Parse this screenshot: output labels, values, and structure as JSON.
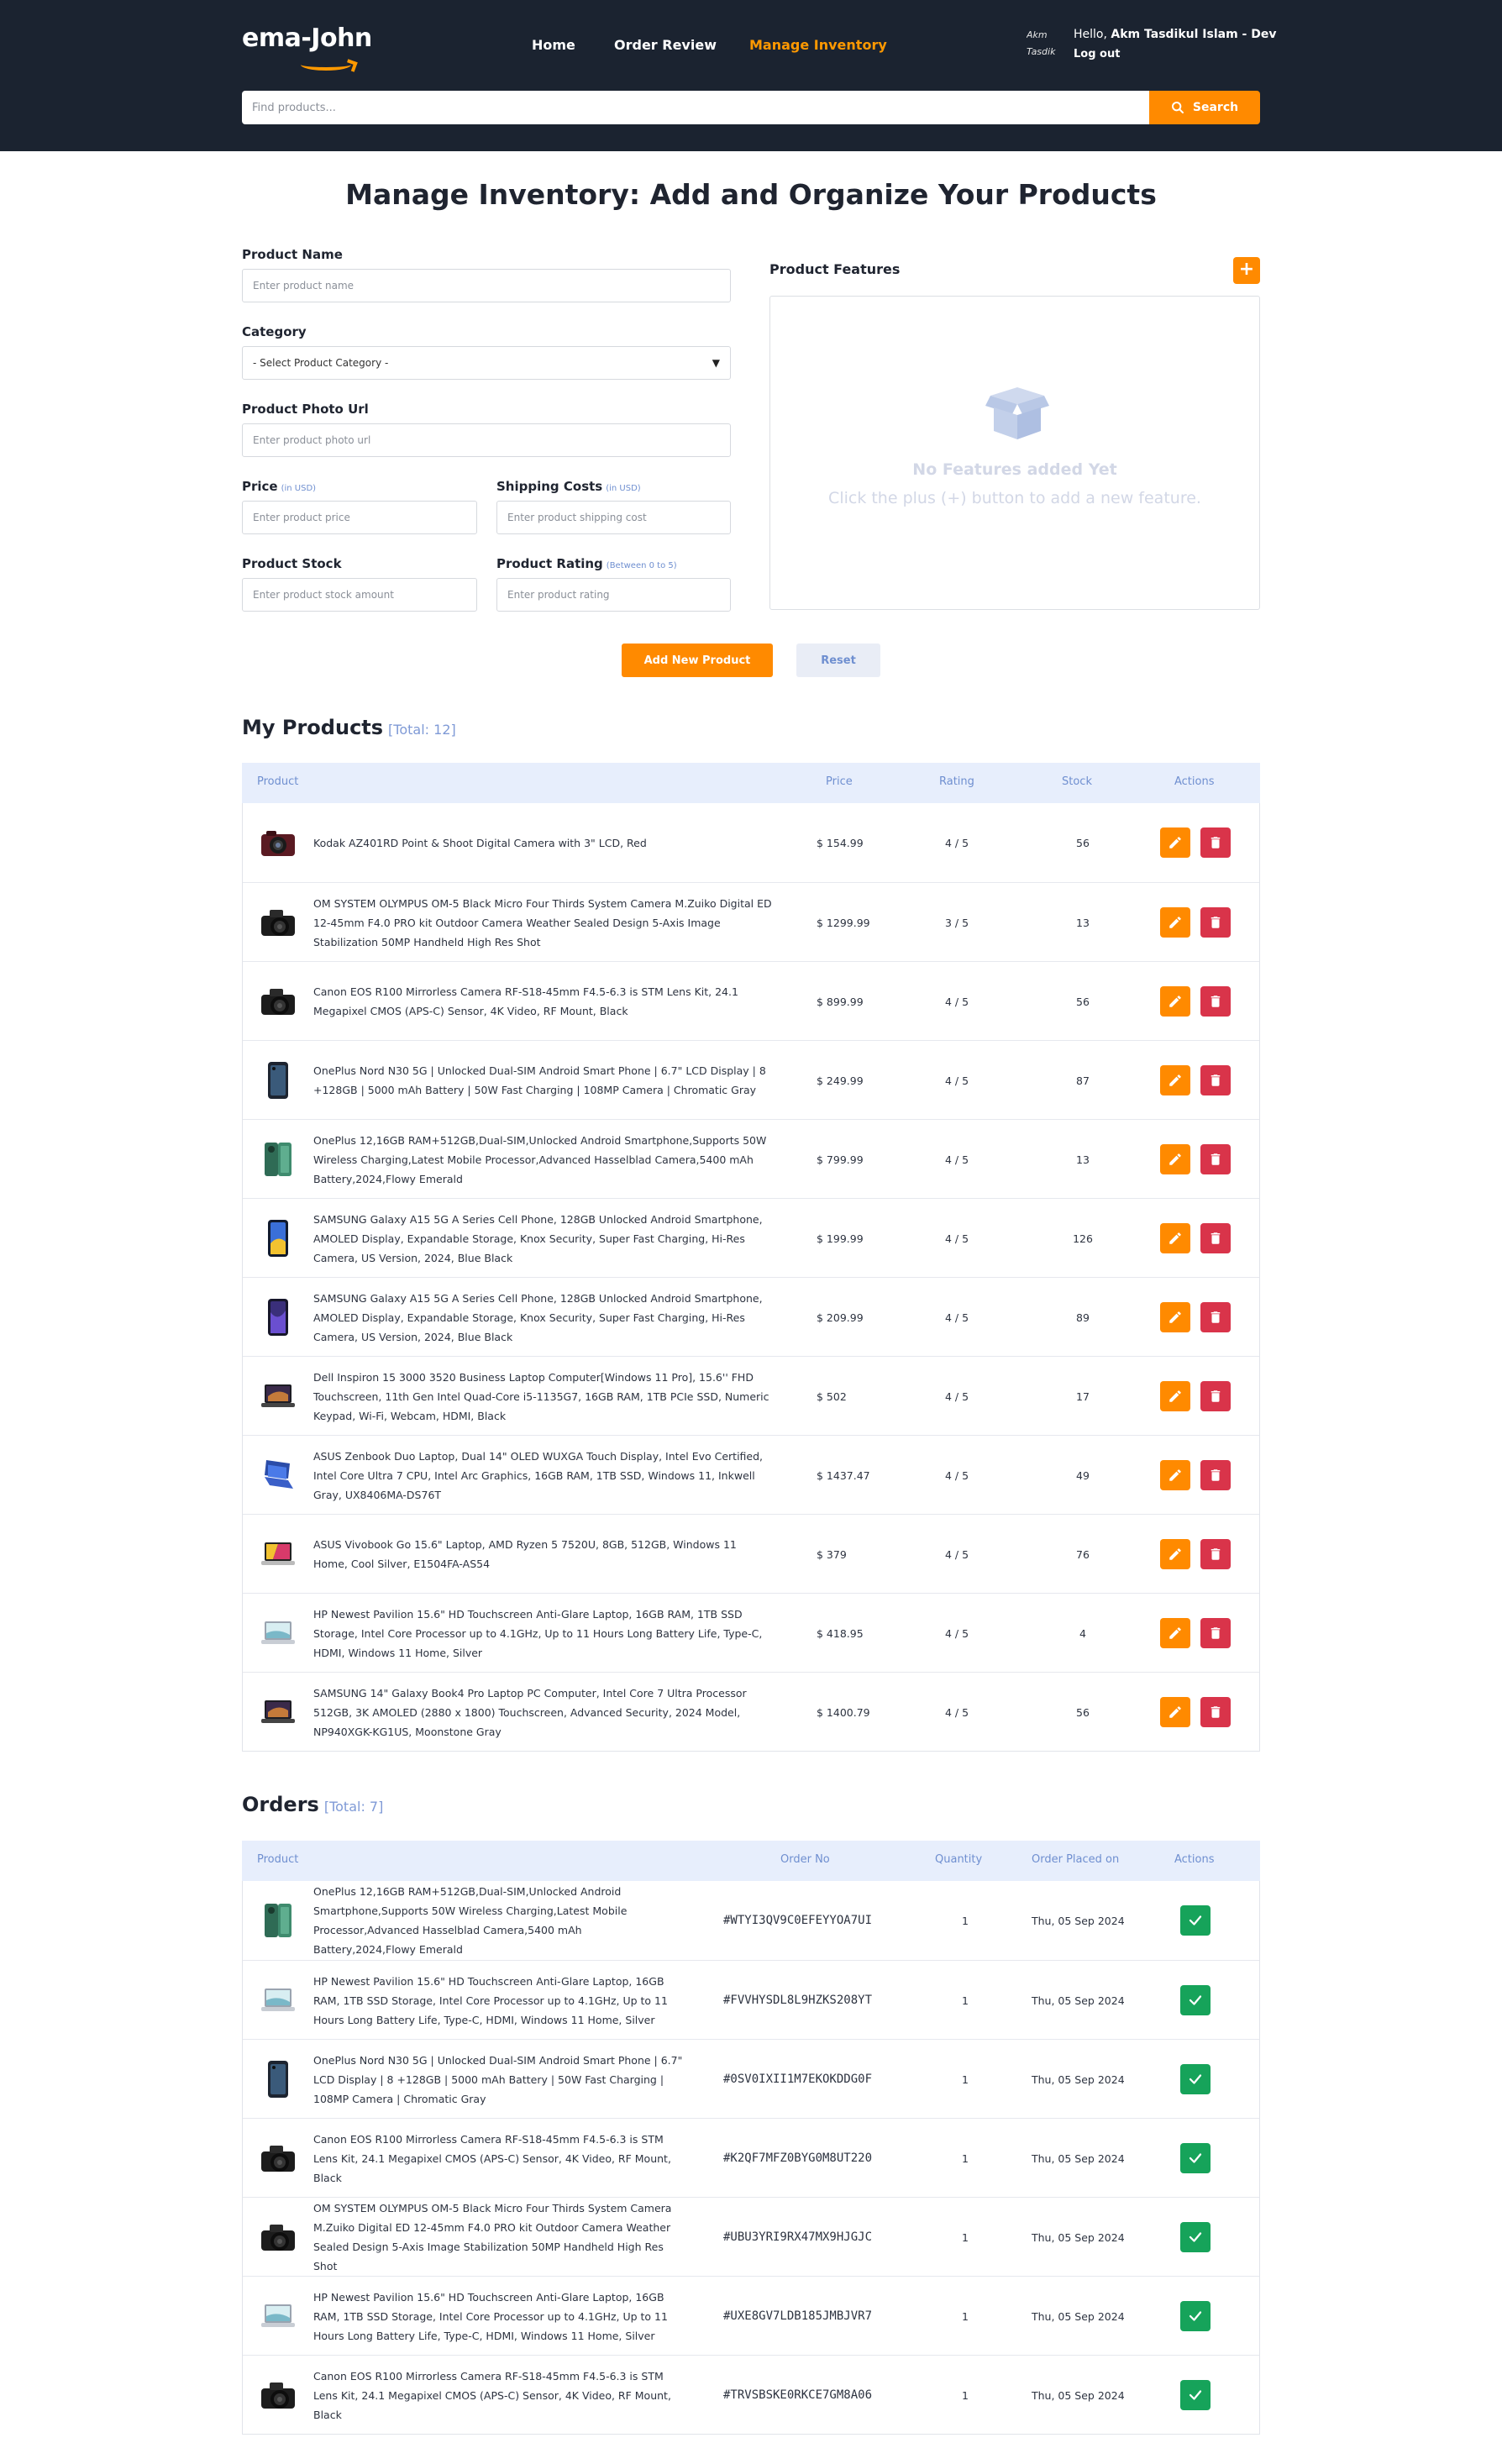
{
  "header": {
    "logo": "ema-John",
    "nav": [
      {
        "label": "Home"
      },
      {
        "label": "Order Review"
      },
      {
        "label": "Manage Inventory"
      }
    ],
    "user": {
      "avatar_alt": "Akm Tasdik",
      "hello": "Hello,",
      "name": "Akm Tasdikul Islam - Dev",
      "logout": "Log out"
    },
    "search": {
      "placeholder": "Find products...",
      "button": "Search"
    },
    "colors": {
      "background": "#1b2330",
      "accent": "#ff8a00"
    }
  },
  "page": {
    "title": "Manage Inventory: Add and Organize Your Products"
  },
  "form": {
    "name": {
      "label": "Product Name",
      "placeholder": "Enter product name"
    },
    "category": {
      "label": "Category",
      "value": "- Select Product Category -"
    },
    "photo": {
      "label": "Product Photo Url",
      "placeholder": "Enter product photo url"
    },
    "price": {
      "label": "Price",
      "hint": "(in USD)",
      "placeholder": "Enter product price"
    },
    "shipping": {
      "label": "Shipping Costs",
      "hint": "(in USD)",
      "placeholder": "Enter product shipping cost"
    },
    "stock": {
      "label": "Product Stock",
      "placeholder": "Enter product stock amount"
    },
    "rating": {
      "label": "Product Rating",
      "hint": "(Between 0 to 5)",
      "placeholder": "Enter product rating"
    },
    "features": {
      "label": "Product Features",
      "add": "+",
      "empty_title": "No Features added Yet",
      "empty_sub": "Click the plus (+) button to add a new feature."
    },
    "add_button": "Add New Product",
    "reset_button": "Reset"
  },
  "products": {
    "title": "My Products",
    "total": "[Total: 12]",
    "columns": [
      "Product",
      "Price",
      "Rating",
      "Stock",
      "Actions"
    ],
    "rows": [
      {
        "name": "Kodak AZ401RD Point & Shoot Digital Camera with 3\" LCD, Red",
        "price": "$ 154.99",
        "rating": "4 / 5",
        "stock": "56",
        "thumb": "camera-red"
      },
      {
        "name": "OM SYSTEM OLYMPUS OM-5 Black Micro Four Thirds System Camera M.Zuiko Digital ED 12-45mm F4.0 PRO kit Outdoor Camera Weather Sealed Design 5-Axis Image Stabilization 50MP Handheld High Res Shot",
        "price": "$ 1299.99",
        "rating": "3 / 5",
        "stock": "13",
        "thumb": "camera-black"
      },
      {
        "name": "Canon EOS R100 Mirrorless Camera RF-S18-45mm F4.5-6.3 is STM Lens Kit, 24.1 Megapixel CMOS (APS-C) Sensor, 4K Video, RF Mount, Black",
        "price": "$ 899.99",
        "rating": "4 / 5",
        "stock": "56",
        "thumb": "camera-black"
      },
      {
        "name": "OnePlus Nord N30 5G | Unlocked Dual-SIM Android Smart Phone | 6.7\" LCD Display | 8 +128GB | 5000 mAh Battery | 50W Fast Charging | 108MP Camera | Chromatic Gray",
        "price": "$ 249.99",
        "rating": "4 / 5",
        "stock": "87",
        "thumb": "phone-dark"
      },
      {
        "name": "OnePlus 12,16GB RAM+512GB,Dual-SIM,Unlocked Android Smartphone,Supports 50W Wireless Charging,Latest Mobile Processor,Advanced Hasselblad Camera,5400 mAh Battery,2024,Flowy Emerald",
        "price": "$ 799.99",
        "rating": "4 / 5",
        "stock": "13",
        "thumb": "phone-green"
      },
      {
        "name": "SAMSUNG Galaxy A15 5G A Series Cell Phone, 128GB Unlocked Android Smartphone, AMOLED Display, Expandable Storage, Knox Security, Super Fast Charging, Hi-Res Camera, US Version, 2024, Blue Black",
        "price": "$ 199.99",
        "rating": "4 / 5",
        "stock": "126",
        "thumb": "phone-blue"
      },
      {
        "name": "SAMSUNG Galaxy A15 5G A Series Cell Phone, 128GB Unlocked Android Smartphone, AMOLED Display, Expandable Storage, Knox Security, Super Fast Charging, Hi-Res Camera, US Version, 2024, Blue Black",
        "price": "$ 209.99",
        "rating": "4 / 5",
        "stock": "89",
        "thumb": "phone-purple"
      },
      {
        "name": "Dell Inspiron 15 3000 3520 Business Laptop Computer[Windows 11 Pro], 15.6'' FHD Touchscreen, 11th Gen Intel Quad-Core i5-1135G7, 16GB RAM, 1TB PCIe SSD, Numeric Keypad, Wi-Fi, Webcam, HDMI, Black",
        "price": "$ 502",
        "rating": "4 / 5",
        "stock": "17",
        "thumb": "laptop-dark"
      },
      {
        "name": "ASUS Zenbook Duo Laptop, Dual 14\" OLED WUXGA Touch Display, Intel Evo Certified, Intel Core Ultra 7 CPU, Intel Arc Graphics, 16GB RAM, 1TB SSD, Windows 11, Inkwell Gray, UX8406MA-DS76T",
        "price": "$ 1437.47",
        "rating": "4 / 5",
        "stock": "49",
        "thumb": "laptop-blue"
      },
      {
        "name": "ASUS Vivobook Go 15.6\" Laptop, AMD Ryzen 5 7520U, 8GB, 512GB, Windows 11 Home, Cool Silver, E1504FA-AS54",
        "price": "$ 379",
        "rating": "4 / 5",
        "stock": "76",
        "thumb": "laptop-color"
      },
      {
        "name": "HP Newest Pavilion 15.6\" HD Touchscreen Anti-Glare Laptop, 16GB RAM, 1TB SSD Storage, Intel Core Processor up to 4.1GHz, Up to 11 Hours Long Battery Life, Type-C, HDMI, Windows 11 Home, Silver",
        "price": "$ 418.95",
        "rating": "4 / 5",
        "stock": "4",
        "thumb": "laptop-silver"
      },
      {
        "name": "SAMSUNG 14\" Galaxy Book4 Pro Laptop PC Computer, Intel Core 7 Ultra Processor 512GB, 3K AMOLED (2880 x 1800) Touchscreen, Advanced Security, 2024 Model, NP940XGK-KG1US, Moonstone Gray",
        "price": "$ 1400.79",
        "rating": "4 / 5",
        "stock": "56",
        "thumb": "laptop-dark"
      }
    ]
  },
  "orders": {
    "title": "Orders",
    "total": "[Total: 7]",
    "columns": [
      "Product",
      "Order No",
      "Quantity",
      "Order Placed on",
      "Actions"
    ],
    "rows": [
      {
        "name": "OnePlus 12,16GB RAM+512GB,Dual-SIM,Unlocked Android Smartphone,Supports 50W Wireless Charging,Latest Mobile Processor,Advanced Hasselblad Camera,5400 mAh Battery,2024,Flowy Emerald",
        "order_no": "#WTYI3QV9C0EFEYYOA7UI",
        "qty": "1",
        "date": "Thu, 05 Sep 2024",
        "thumb": "phone-green"
      },
      {
        "name": "HP Newest Pavilion 15.6\" HD Touchscreen Anti-Glare Laptop, 16GB RAM, 1TB SSD Storage, Intel Core Processor up to 4.1GHz, Up to 11 Hours Long Battery Life, Type-C, HDMI, Windows 11 Home, Silver",
        "order_no": "#FVVHYSDL8L9HZKS208YT",
        "qty": "1",
        "date": "Thu, 05 Sep 2024",
        "thumb": "laptop-silver"
      },
      {
        "name": "OnePlus Nord N30 5G | Unlocked Dual-SIM Android Smart Phone | 6.7\" LCD Display | 8 +128GB | 5000 mAh Battery | 50W Fast Charging | 108MP Camera | Chromatic Gray",
        "order_no": "#0SV0IXII1M7EKOKDDG0F",
        "qty": "1",
        "date": "Thu, 05 Sep 2024",
        "thumb": "phone-dark"
      },
      {
        "name": "Canon EOS R100 Mirrorless Camera RF-S18-45mm F4.5-6.3 is STM Lens Kit, 24.1 Megapixel CMOS (APS-C) Sensor, 4K Video, RF Mount, Black",
        "order_no": "#K2QF7MFZ0BYG0M8UT220",
        "qty": "1",
        "date": "Thu, 05 Sep 2024",
        "thumb": "camera-black"
      },
      {
        "name": "OM SYSTEM OLYMPUS OM-5 Black Micro Four Thirds System Camera M.Zuiko Digital ED 12-45mm F4.0 PRO kit Outdoor Camera Weather Sealed Design 5-Axis Image Stabilization 50MP Handheld High Res Shot",
        "order_no": "#UBU3YRI9RX47MX9HJGJC",
        "qty": "1",
        "date": "Thu, 05 Sep 2024",
        "thumb": "camera-black"
      },
      {
        "name": "HP Newest Pavilion 15.6\" HD Touchscreen Anti-Glare Laptop, 16GB RAM, 1TB SSD Storage, Intel Core Processor up to 4.1GHz, Up to 11 Hours Long Battery Life, Type-C, HDMI, Windows 11 Home, Silver",
        "order_no": "#UXE8GV7LDB185JMBJVR7",
        "qty": "1",
        "date": "Thu, 05 Sep 2024",
        "thumb": "laptop-silver"
      },
      {
        "name": "Canon EOS R100 Mirrorless Camera RF-S18-45mm F4.5-6.3 is STM Lens Kit, 24.1 Megapixel CMOS (APS-C) Sensor, 4K Video, RF Mount, Black",
        "order_no": "#TRVSBSKE0RKCE7GM8A06",
        "qty": "1",
        "date": "Thu, 05 Sep 2024",
        "thumb": "camera-black"
      }
    ]
  },
  "colors": {
    "accent": "#ff8a00",
    "danger": "#d9344a",
    "success": "#16a35a",
    "table_head": "#e7eefc",
    "muted_blue": "#6f8fd0"
  }
}
